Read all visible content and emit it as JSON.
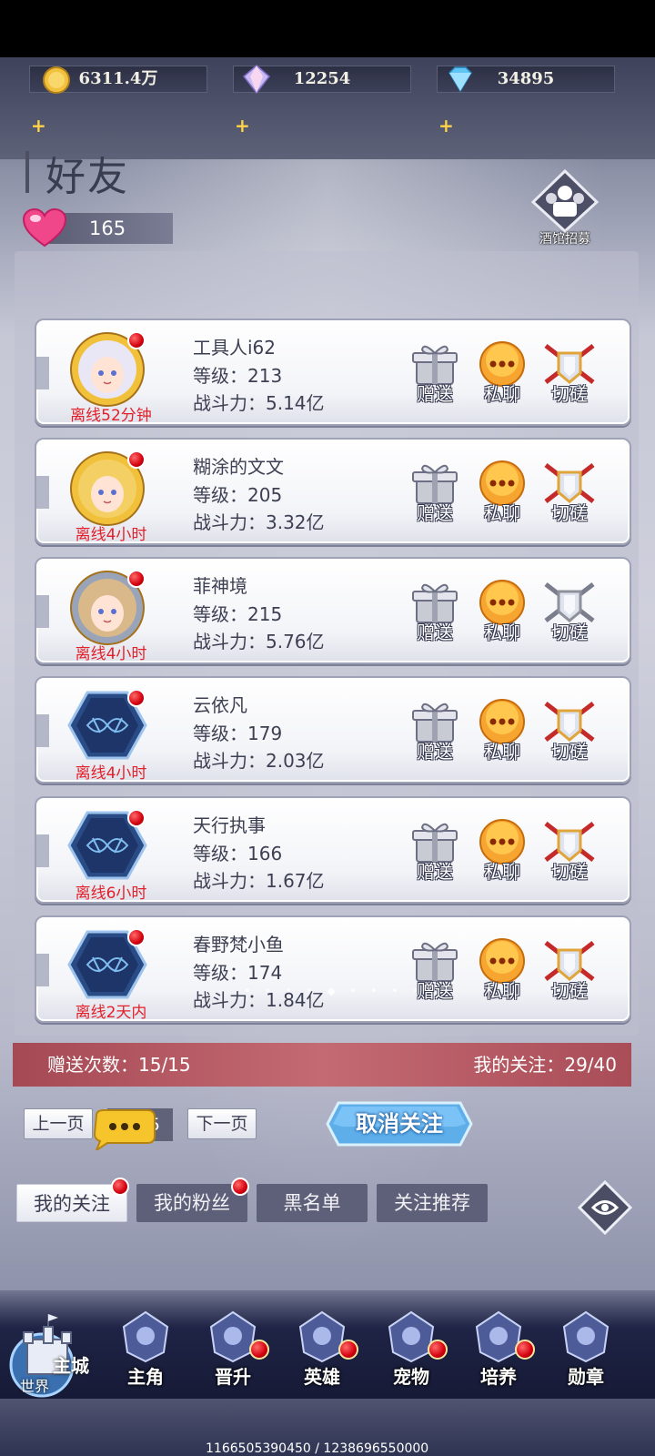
{
  "resources": {
    "gold": "6311.4万",
    "crystal": "12254",
    "diamond": "34895"
  },
  "page_title": "好友",
  "hearts": "165",
  "recruit_label": "酒馆招募",
  "friends": [
    {
      "name": "工具人i62",
      "level": "等级：213",
      "power": "战斗力：5.14亿",
      "status": "离线52分钟",
      "avatar": "hero-white-hair-avatar",
      "duel_active": true
    },
    {
      "name": "糊涂的文文",
      "level": "等级：205",
      "power": "战斗力：3.32亿",
      "status": "离线4小时",
      "avatar": "hero-blonde-avatar",
      "duel_active": true
    },
    {
      "name": "菲神境",
      "level": "等级：215",
      "power": "战斗力：5.76亿",
      "status": "离线4小时",
      "avatar": "hero-goggles-avatar",
      "duel_active": false
    },
    {
      "name": "云依凡",
      "level": "等级：179",
      "power": "战斗力：2.03亿",
      "status": "离线4小时",
      "avatar": "default-emblem-avatar",
      "duel_active": true
    },
    {
      "name": "天行执事",
      "level": "等级：166",
      "power": "战斗力：1.67亿",
      "status": "离线6小时",
      "avatar": "default-emblem-avatar",
      "duel_active": true
    },
    {
      "name": "春野梵小鱼",
      "level": "等级：174",
      "power": "战斗力：1.84亿",
      "status": "离线2天内",
      "avatar": "default-emblem-avatar",
      "duel_active": true
    }
  ],
  "actions": {
    "gift": "赠送",
    "chat": "私聊",
    "duel": "切磋"
  },
  "info": {
    "gift_count": "赠送次数：15/15",
    "follow_count": "我的关注：29/40"
  },
  "pager": {
    "prev": "上一页",
    "next": "下一页",
    "page": "5"
  },
  "unfollow_label": "取消关注",
  "tabs": [
    {
      "label": "我的关注",
      "active": true,
      "dot": true
    },
    {
      "label": "我的粉丝",
      "active": false,
      "dot": true
    },
    {
      "label": "黑名单",
      "active": false,
      "dot": false
    },
    {
      "label": "关注推荐",
      "active": false,
      "dot": false
    }
  ],
  "nav": {
    "world": "世界",
    "main_city": "主城",
    "items": [
      {
        "label": "主角",
        "icon": "hero-icon",
        "dot": false
      },
      {
        "label": "晋升",
        "icon": "promote-icon",
        "dot": true
      },
      {
        "label": "英雄",
        "icon": "helmet-icon",
        "dot": true
      },
      {
        "label": "宠物",
        "icon": "pet-icon",
        "dot": true
      },
      {
        "label": "培养",
        "icon": "train-icon",
        "dot": true
      },
      {
        "label": "勋章",
        "icon": "medal-icon",
        "dot": false
      }
    ]
  },
  "debug_text": "1166505390450 / 1238696550000",
  "colors": {
    "status_red": "#e3202a",
    "info_bar": "#b55a63",
    "tab_inactive": "#5d6078"
  }
}
